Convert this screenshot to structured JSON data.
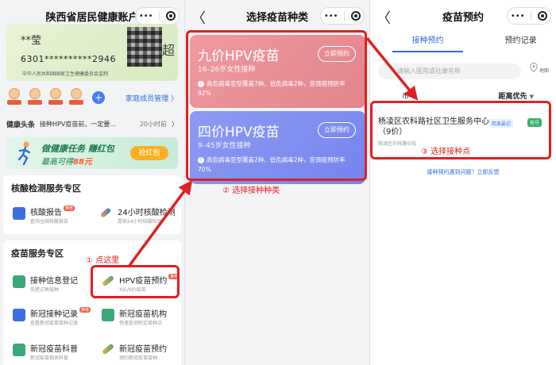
{
  "panel1": {
    "title": "陕西省居民健康账户",
    "capsule_more": "•••",
    "card": {
      "name": "**莹",
      "number": "6301**********2946",
      "issuer": "中华人民共和国国家卫生健康委员会监制",
      "edge_char": "超"
    },
    "family_link": "家庭成员管理 〉",
    "headline": {
      "title": "健康头条",
      "text": "接种HPV疫苗前，一定要…",
      "time": "20小时前",
      "chevron": "〉"
    },
    "banner": {
      "line1": "做健康任务 赚红包",
      "line2_prefix": "最高可得",
      "line2_amount": "88元",
      "button": "抢红包"
    },
    "nucleic_section": {
      "title": "核酸检测服务专区",
      "items": [
        {
          "label": "核酸报告",
          "badge": "推荐",
          "sub": "查询全国核酸报告"
        },
        {
          "label": "24小时核酸检测",
          "sub": "提供24小时核酸检测"
        }
      ]
    },
    "vaccine_section": {
      "title": "疫苗服务专区",
      "items": [
        {
          "label": "接种信息登记",
          "sub": "先登记再接种"
        },
        {
          "label": "HPV疫苗预约",
          "badge": "推荐",
          "sub": "4价/9价疫苗"
        },
        {
          "label": "新冠接种记录",
          "badge": "推荐",
          "sub": "查看新冠疫苗接种记录"
        },
        {
          "label": "新冠疫苗机构",
          "sub": "快速查询附近接种点"
        },
        {
          "label": "新冠疫苗科普",
          "sub": "新冠疫苗相关科普"
        },
        {
          "label": "新冠疫苗预约",
          "sub": "预约新冠疫苗接种"
        }
      ]
    }
  },
  "panel2": {
    "title": "选择疫苗种类",
    "back": "〈",
    "cards": [
      {
        "title": "九价HPV疫苗",
        "sub": "16–26岁女性接种",
        "desc": "高危病毒亚型覆盖7种、低危病毒2种，宫颈癌预防率92%",
        "button": "立即预约"
      },
      {
        "title": "四价HPV疫苗",
        "sub": "9–45岁女性接种",
        "desc": "高危病毒亚型覆盖2种、低危病毒2种，宫颈癌预防率70%",
        "button": "立即预约"
      }
    ]
  },
  "panel3": {
    "title": "疫苗预约",
    "back": "〈",
    "tabs": [
      "接种预约",
      "预约记录"
    ],
    "search_placeholder": "请输入医院或社康名称",
    "map_label": "地图",
    "filter_city": "市",
    "filter_sort": "距离优先",
    "site": {
      "name": "杨凌区农科路社区卫生服务中心（9价）",
      "address": "杨凌区农科路中段",
      "tag_near": "距离最近",
      "tag_status": "有号"
    },
    "help": "接种预约遇到问题？立即反馈"
  },
  "annotations": {
    "step1": "① 点这里",
    "step2": "② 选择接种种类",
    "step3": "③ 选择接种点"
  },
  "colors": {
    "accent": "#2f6bdc",
    "annotation": "#e02020",
    "card_nine": "#e88c93",
    "card_four": "#7f8ff0"
  }
}
